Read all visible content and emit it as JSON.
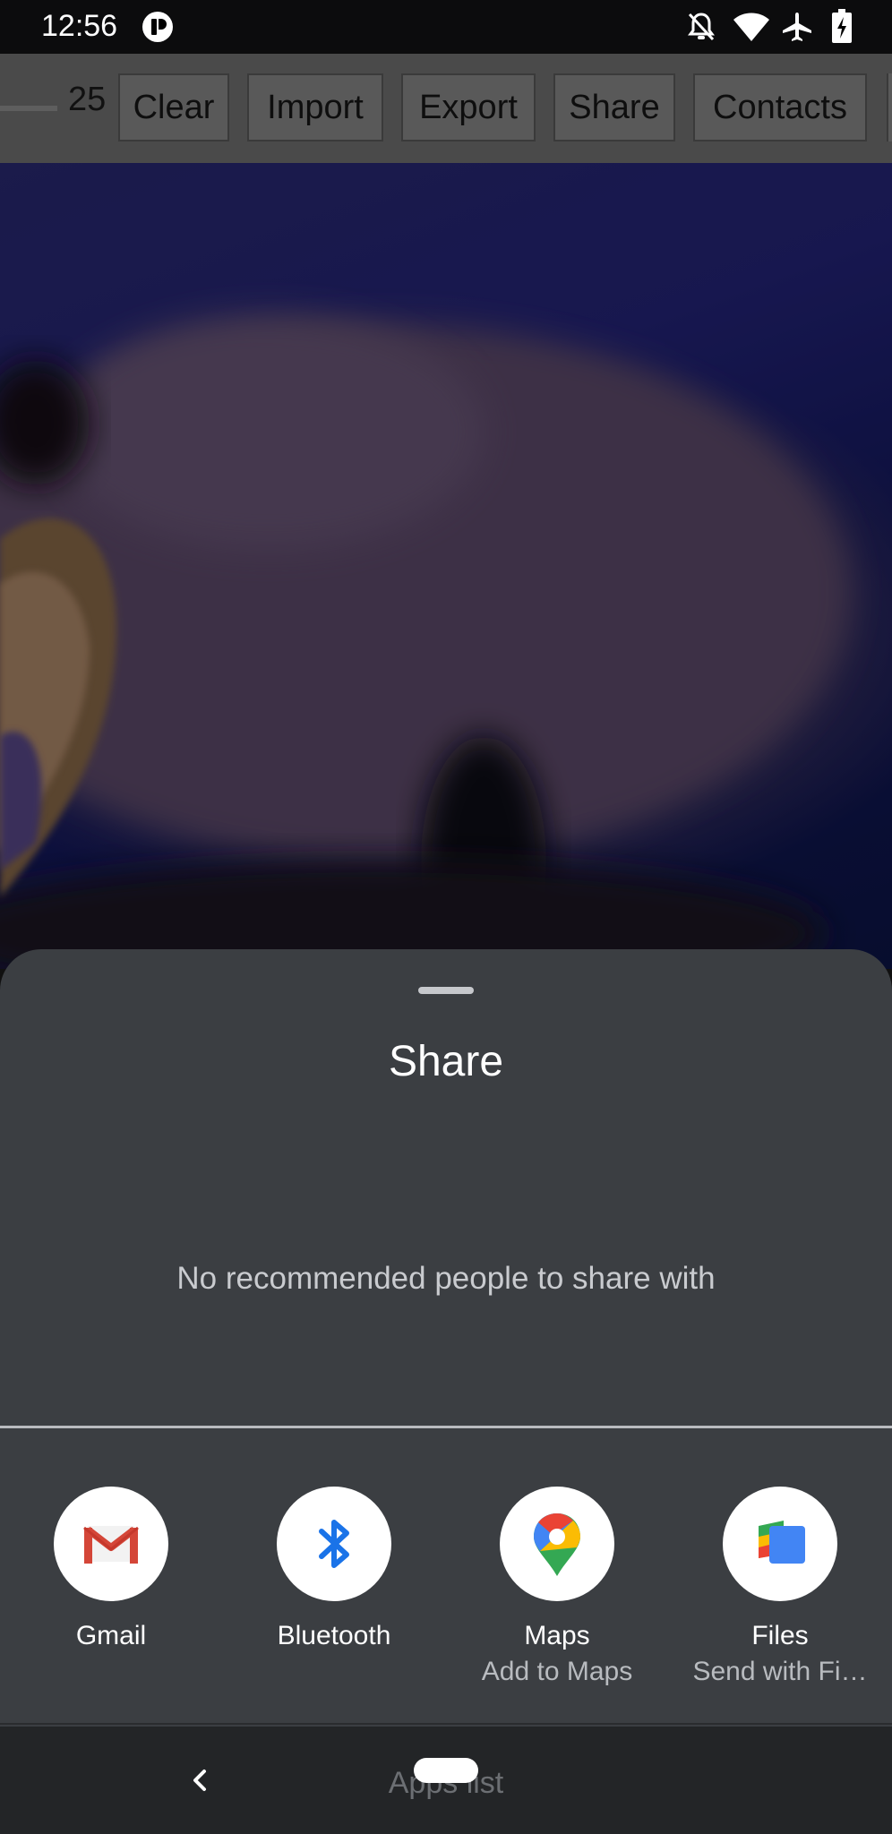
{
  "status_bar": {
    "time": "12:56",
    "icons": [
      "app-notification-icon",
      "do-not-disturb-icon",
      "wifi-icon",
      "airplane-icon",
      "battery-charging-icon"
    ]
  },
  "toolbar": {
    "value": "25",
    "buttons": [
      "Clear",
      "Import",
      "Export",
      "Share",
      "Contacts"
    ]
  },
  "share_sheet": {
    "title": "Share",
    "empty_message": "No recommended people to share with",
    "apps": [
      {
        "label": "Gmail",
        "sublabel": "",
        "icon": "gmail-icon"
      },
      {
        "label": "Bluetooth",
        "sublabel": "",
        "icon": "bluetooth-icon"
      },
      {
        "label": "Maps",
        "sublabel": "Add to Maps",
        "icon": "maps-icon"
      },
      {
        "label": "Files",
        "sublabel": "Send with Fi…",
        "icon": "files-icon"
      }
    ]
  },
  "nav_bar": {
    "hint": "Apps list"
  },
  "colors": {
    "sheet_background": "#3b3e42",
    "toolbar_background": "#4a4a4a",
    "nav_background": "#232527"
  }
}
